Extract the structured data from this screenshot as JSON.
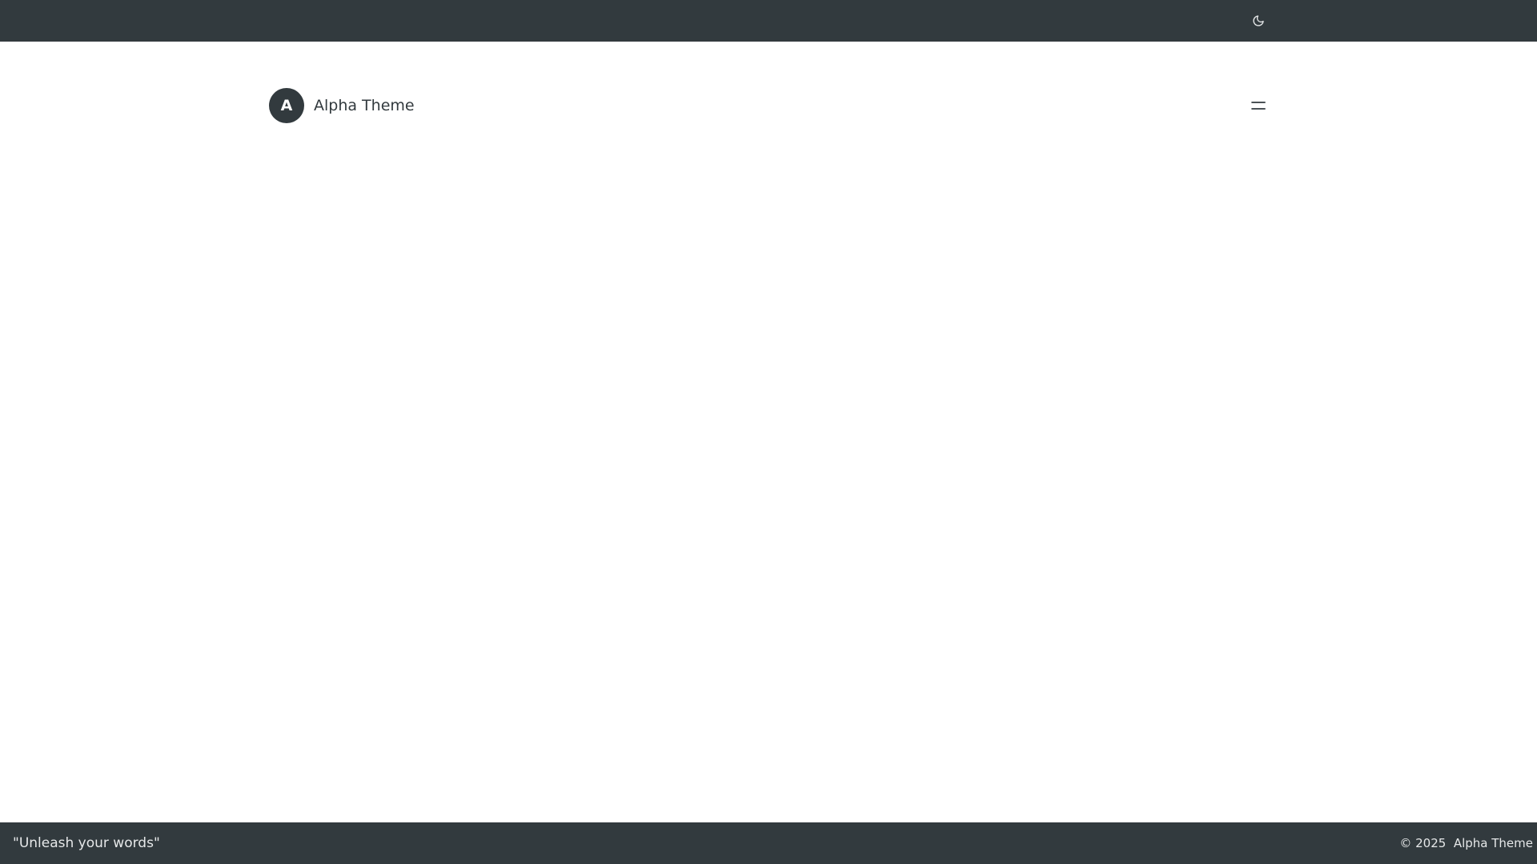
{
  "topbar": {
    "theme_toggle_icon": "moon-icon",
    "background_color": "#323a3e"
  },
  "header": {
    "avatar_letter": "A",
    "site_title": "Alpha Theme",
    "menu_icon": "menu-icon"
  },
  "footer": {
    "tagline": "\"Unleash your words\"",
    "copyright_symbol_year": "© 2025",
    "copyright_name": "Alpha Theme",
    "background_color": "#323a3e"
  },
  "colors": {
    "text_dark": "#323a3e",
    "text_light": "#e6e8e9",
    "page_background": "#ffffff"
  }
}
